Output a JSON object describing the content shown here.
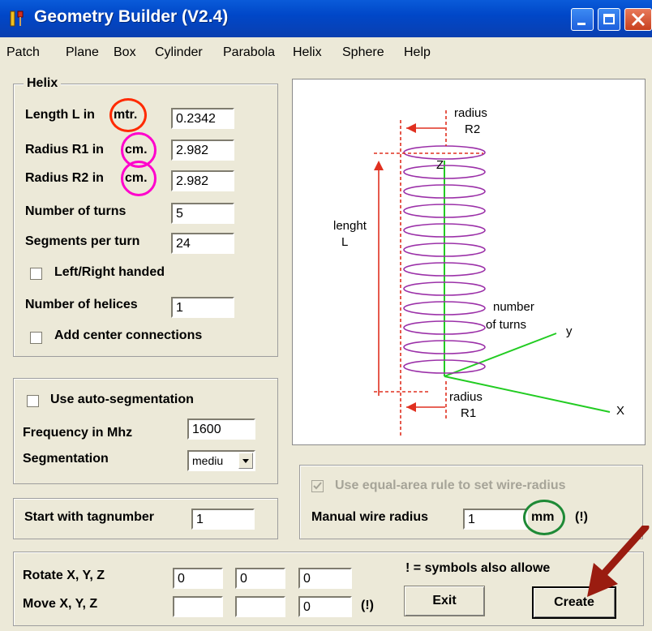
{
  "window": {
    "title": "Geometry Builder (V2.4)"
  },
  "menu": [
    "Patch",
    "Plane",
    "Box",
    "Cylinder",
    "Parabola",
    "Helix",
    "Sphere",
    "Help"
  ],
  "helix": {
    "legend": "Helix",
    "length_label": "Length L in",
    "length_unit": "mtr.",
    "length_value": "0.2342",
    "r1_label": "Radius R1 in",
    "r1_unit": "cm.",
    "r1_value": "2.982",
    "r2_label": "Radius R2 in",
    "r2_unit": "cm.",
    "r2_value": "2.982",
    "turns_label": "Number of turns",
    "turns_value": "5",
    "segments_label": "Segments per turn",
    "segments_value": "24",
    "handed_label": "Left/Right handed",
    "helices_label": "Number of helices",
    "helices_value": "1",
    "center_label": "Add center connections"
  },
  "auto_seg": {
    "checkbox_label": "Use auto-segmentation",
    "freq_label": "Frequency in Mhz",
    "freq_value": "1600",
    "seg_label": "Segmentation",
    "seg_value": "mediu"
  },
  "tag": {
    "label": "Start with tagnumber",
    "value": "1"
  },
  "wire": {
    "equal_area_label": "Use equal-area rule to set wire-radius",
    "manual_label": "Manual wire radius",
    "manual_value": "1",
    "unit": "mm",
    "note": "(!)"
  },
  "transform": {
    "rotate_label": "Rotate X, Y, Z",
    "rotate_values": [
      "0",
      "0",
      "0"
    ],
    "move_label": "Move X, Y, Z",
    "move_values": [
      "",
      "",
      "0"
    ],
    "note": "(!)"
  },
  "symbols_note": "! =  symbols also allowe",
  "buttons": {
    "exit": "Exit",
    "create": "Create"
  },
  "diagram": {
    "radius_r2": "radius",
    "r2": "R2",
    "z": "Z",
    "lenght": "lenght",
    "l": "L",
    "number": "number",
    "of_turns": "of  turns",
    "y": "y",
    "radius_r1": "radius",
    "r1": "R1",
    "x": "X"
  },
  "colors": {
    "title_bar": "#0047c8",
    "helix_purple": "#9b30a8",
    "dimension_red": "#e03020",
    "axis_green": "#22cc22",
    "ring_red": "#ff2a00",
    "ring_magenta": "#ff00cc",
    "ring_green": "#1e8a36",
    "arrow_darkred": "#9a1c10"
  }
}
